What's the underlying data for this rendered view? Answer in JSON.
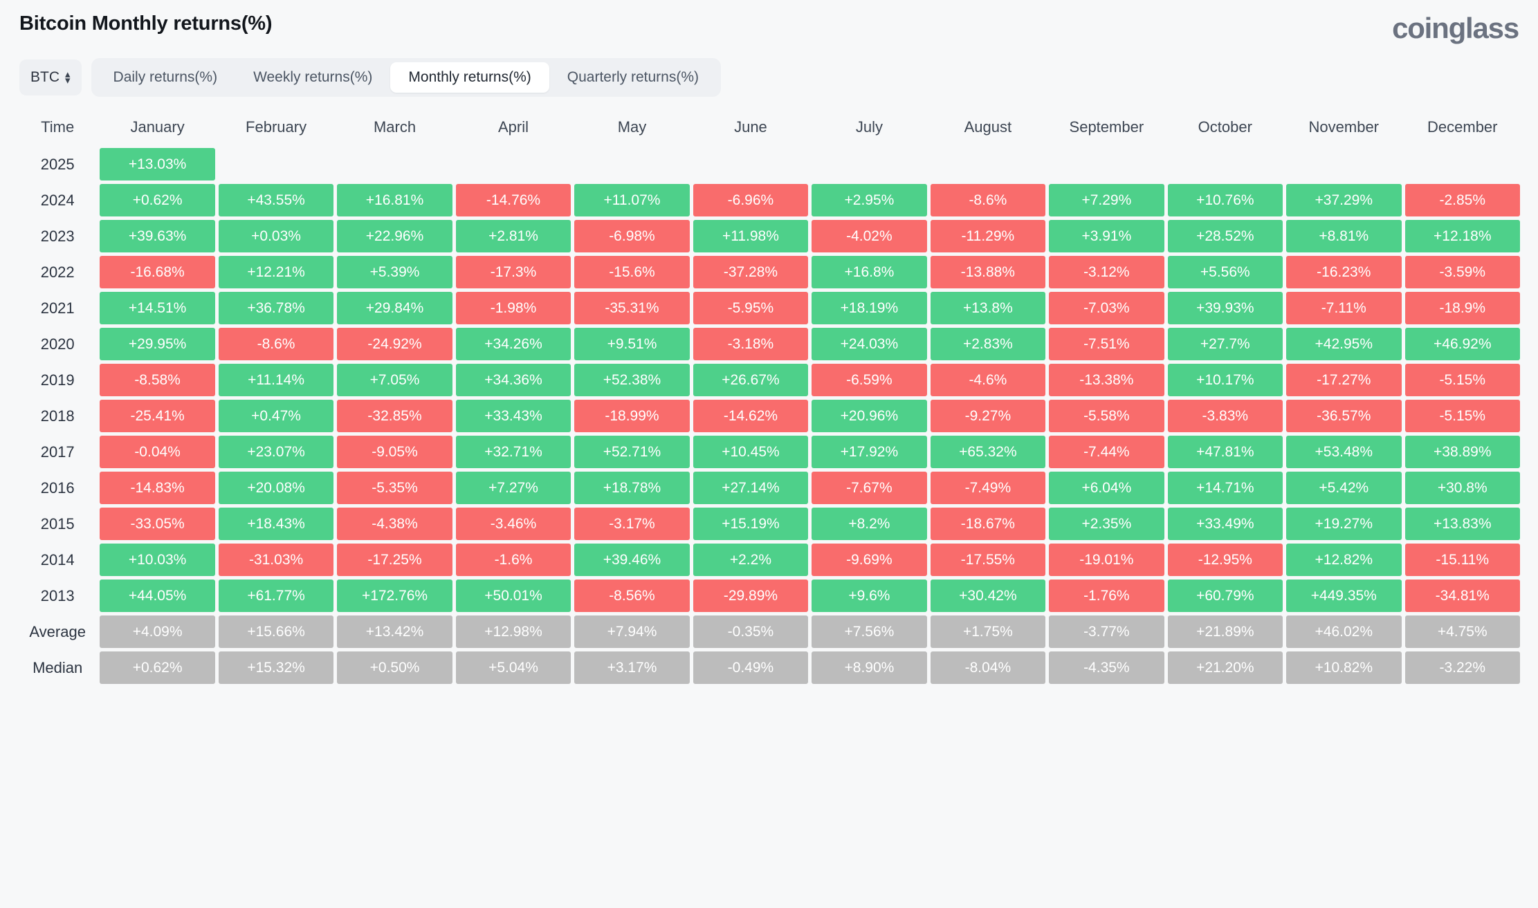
{
  "header": {
    "title": "Bitcoin Monthly returns(%)",
    "brand": "coinglass"
  },
  "controls": {
    "symbol_label": "BTC",
    "symbol_icon": "up-down-chevron-icon",
    "tabs": [
      {
        "label": "Daily returns(%)",
        "active": false
      },
      {
        "label": "Weekly returns(%)",
        "active": false
      },
      {
        "label": "Monthly returns(%)",
        "active": true
      },
      {
        "label": "Quarterly returns(%)",
        "active": false
      }
    ]
  },
  "colors": {
    "positive": "#4ed08a",
    "negative": "#f96c6c",
    "stat": "#bcbcbc",
    "page_background": "#f7f8f9",
    "title": "#12161c",
    "brand": "#6b7280"
  },
  "chart_data": {
    "type": "heatmap",
    "title": "Bitcoin Monthly returns(%)",
    "xlabel": "",
    "ylabel": "Time",
    "unit": "%",
    "time_header": "Time",
    "categories": [
      "January",
      "February",
      "March",
      "April",
      "May",
      "June",
      "July",
      "August",
      "September",
      "October",
      "November",
      "December"
    ],
    "rows": [
      {
        "label": "2025",
        "values": [
          "+13.03%",
          "",
          "",
          "",
          "",
          "",
          "",
          "",
          "",
          "",
          "",
          ""
        ]
      },
      {
        "label": "2024",
        "values": [
          "+0.62%",
          "+43.55%",
          "+16.81%",
          "-14.76%",
          "+11.07%",
          "-6.96%",
          "+2.95%",
          "-8.6%",
          "+7.29%",
          "+10.76%",
          "+37.29%",
          "-2.85%"
        ]
      },
      {
        "label": "2023",
        "values": [
          "+39.63%",
          "+0.03%",
          "+22.96%",
          "+2.81%",
          "-6.98%",
          "+11.98%",
          "-4.02%",
          "-11.29%",
          "+3.91%",
          "+28.52%",
          "+8.81%",
          "+12.18%"
        ]
      },
      {
        "label": "2022",
        "values": [
          "-16.68%",
          "+12.21%",
          "+5.39%",
          "-17.3%",
          "-15.6%",
          "-37.28%",
          "+16.8%",
          "-13.88%",
          "-3.12%",
          "+5.56%",
          "-16.23%",
          "-3.59%"
        ]
      },
      {
        "label": "2021",
        "values": [
          "+14.51%",
          "+36.78%",
          "+29.84%",
          "-1.98%",
          "-35.31%",
          "-5.95%",
          "+18.19%",
          "+13.8%",
          "-7.03%",
          "+39.93%",
          "-7.11%",
          "-18.9%"
        ]
      },
      {
        "label": "2020",
        "values": [
          "+29.95%",
          "-8.6%",
          "-24.92%",
          "+34.26%",
          "+9.51%",
          "-3.18%",
          "+24.03%",
          "+2.83%",
          "-7.51%",
          "+27.7%",
          "+42.95%",
          "+46.92%"
        ]
      },
      {
        "label": "2019",
        "values": [
          "-8.58%",
          "+11.14%",
          "+7.05%",
          "+34.36%",
          "+52.38%",
          "+26.67%",
          "-6.59%",
          "-4.6%",
          "-13.38%",
          "+10.17%",
          "-17.27%",
          "-5.15%"
        ]
      },
      {
        "label": "2018",
        "values": [
          "-25.41%",
          "+0.47%",
          "-32.85%",
          "+33.43%",
          "-18.99%",
          "-14.62%",
          "+20.96%",
          "-9.27%",
          "-5.58%",
          "-3.83%",
          "-36.57%",
          "-5.15%"
        ]
      },
      {
        "label": "2017",
        "values": [
          "-0.04%",
          "+23.07%",
          "-9.05%",
          "+32.71%",
          "+52.71%",
          "+10.45%",
          "+17.92%",
          "+65.32%",
          "-7.44%",
          "+47.81%",
          "+53.48%",
          "+38.89%"
        ]
      },
      {
        "label": "2016",
        "values": [
          "-14.83%",
          "+20.08%",
          "-5.35%",
          "+7.27%",
          "+18.78%",
          "+27.14%",
          "-7.67%",
          "-7.49%",
          "+6.04%",
          "+14.71%",
          "+5.42%",
          "+30.8%"
        ]
      },
      {
        "label": "2015",
        "values": [
          "-33.05%",
          "+18.43%",
          "-4.38%",
          "-3.46%",
          "-3.17%",
          "+15.19%",
          "+8.2%",
          "-18.67%",
          "+2.35%",
          "+33.49%",
          "+19.27%",
          "+13.83%"
        ]
      },
      {
        "label": "2014",
        "values": [
          "+10.03%",
          "-31.03%",
          "-17.25%",
          "-1.6%",
          "+39.46%",
          "+2.2%",
          "-9.69%",
          "-17.55%",
          "-19.01%",
          "-12.95%",
          "+12.82%",
          "-15.11%"
        ]
      },
      {
        "label": "2013",
        "values": [
          "+44.05%",
          "+61.77%",
          "+172.76%",
          "+50.01%",
          "-8.56%",
          "-29.89%",
          "+9.6%",
          "+30.42%",
          "-1.76%",
          "+60.79%",
          "+449.35%",
          "-34.81%"
        ]
      }
    ],
    "summary_rows": [
      {
        "label": "Average",
        "values": [
          "+4.09%",
          "+15.66%",
          "+13.42%",
          "+12.98%",
          "+7.94%",
          "-0.35%",
          "+7.56%",
          "+1.75%",
          "-3.77%",
          "+21.89%",
          "+46.02%",
          "+4.75%"
        ]
      },
      {
        "label": "Median",
        "values": [
          "+0.62%",
          "+15.32%",
          "+0.50%",
          "+5.04%",
          "+3.17%",
          "-0.49%",
          "+8.90%",
          "-8.04%",
          "-4.35%",
          "+21.20%",
          "+10.82%",
          "-3.22%"
        ]
      }
    ]
  }
}
